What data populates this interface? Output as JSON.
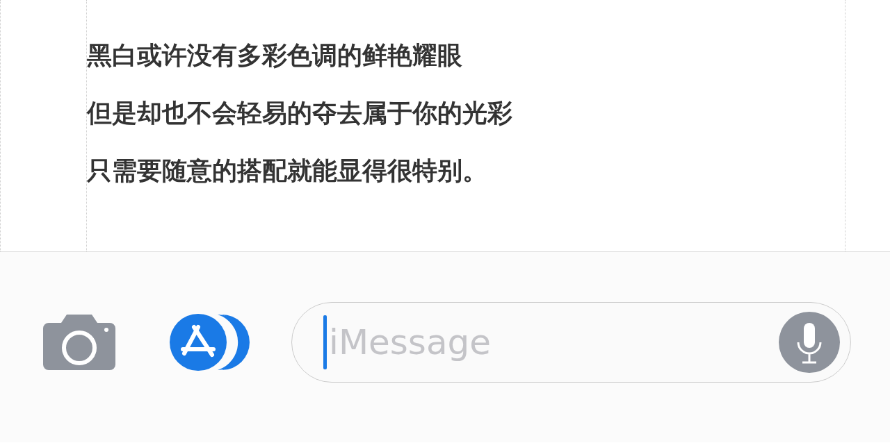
{
  "message": {
    "lines": [
      "黑白或许没有多彩色调的鲜艳耀眼",
      "但是却也不会轻易的夺去属于你的光彩",
      "只需要随意的搭配就能显得很特别。"
    ]
  },
  "composer": {
    "placeholder": "iMessage"
  }
}
